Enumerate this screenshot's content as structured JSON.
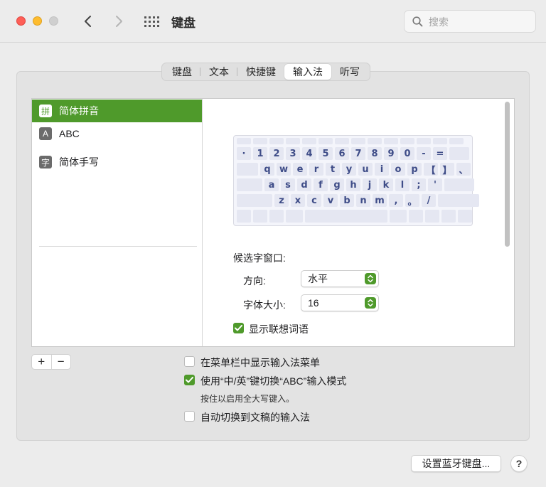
{
  "window": {
    "title": "键盘"
  },
  "search": {
    "placeholder": "搜索"
  },
  "tabs": [
    {
      "label": "键盘",
      "active": false
    },
    {
      "label": "文本",
      "active": false
    },
    {
      "label": "快捷键",
      "active": false
    },
    {
      "label": "输入法",
      "active": true
    },
    {
      "label": "听写",
      "active": false
    }
  ],
  "input_sources": [
    {
      "badge": "拼",
      "label": "简体拼音",
      "selected": true
    },
    {
      "badge": "A",
      "label": "ABC",
      "selected": false
    },
    {
      "badge": "字",
      "label": "简体手写",
      "selected": false
    }
  ],
  "keyboard": {
    "row1": [
      "·",
      "1",
      "2",
      "3",
      "4",
      "5",
      "6",
      "7",
      "8",
      "9",
      "0",
      "-",
      "="
    ],
    "row2": [
      "q",
      "w",
      "e",
      "r",
      "t",
      "y",
      "u",
      "i",
      "o",
      "p",
      "【",
      "】",
      "、"
    ],
    "row3": [
      "a",
      "s",
      "d",
      "f",
      "g",
      "h",
      "j",
      "k",
      "l",
      ";",
      "'"
    ],
    "row4": [
      "z",
      "x",
      "c",
      "v",
      "b",
      "n",
      "m",
      ",",
      "。",
      "/"
    ]
  },
  "candidate_window": {
    "heading": "候选字窗口:",
    "direction_label": "方向:",
    "direction_value": "水平",
    "font_size_label": "字体大小:",
    "font_size_value": "16",
    "show_predictions_label": "显示联想词语",
    "show_predictions_checked": true
  },
  "list_controls": {
    "add": "+",
    "remove": "−"
  },
  "options": {
    "show_menu_label": "在菜单栏中显示输入法菜单",
    "show_menu_checked": false,
    "toggle_abc_label": "使用“中/英”键切换“ABC”输入模式",
    "toggle_abc_checked": true,
    "toggle_abc_hint": "按住以启用全大写键入。",
    "auto_switch_label": "自动切换到文稿的输入法",
    "auto_switch_checked": false
  },
  "footer": {
    "bluetooth_button": "设置蓝牙键盘...",
    "help": "?"
  },
  "colors": {
    "accent": "#4f9a2b",
    "key_text": "#3f4d88"
  }
}
